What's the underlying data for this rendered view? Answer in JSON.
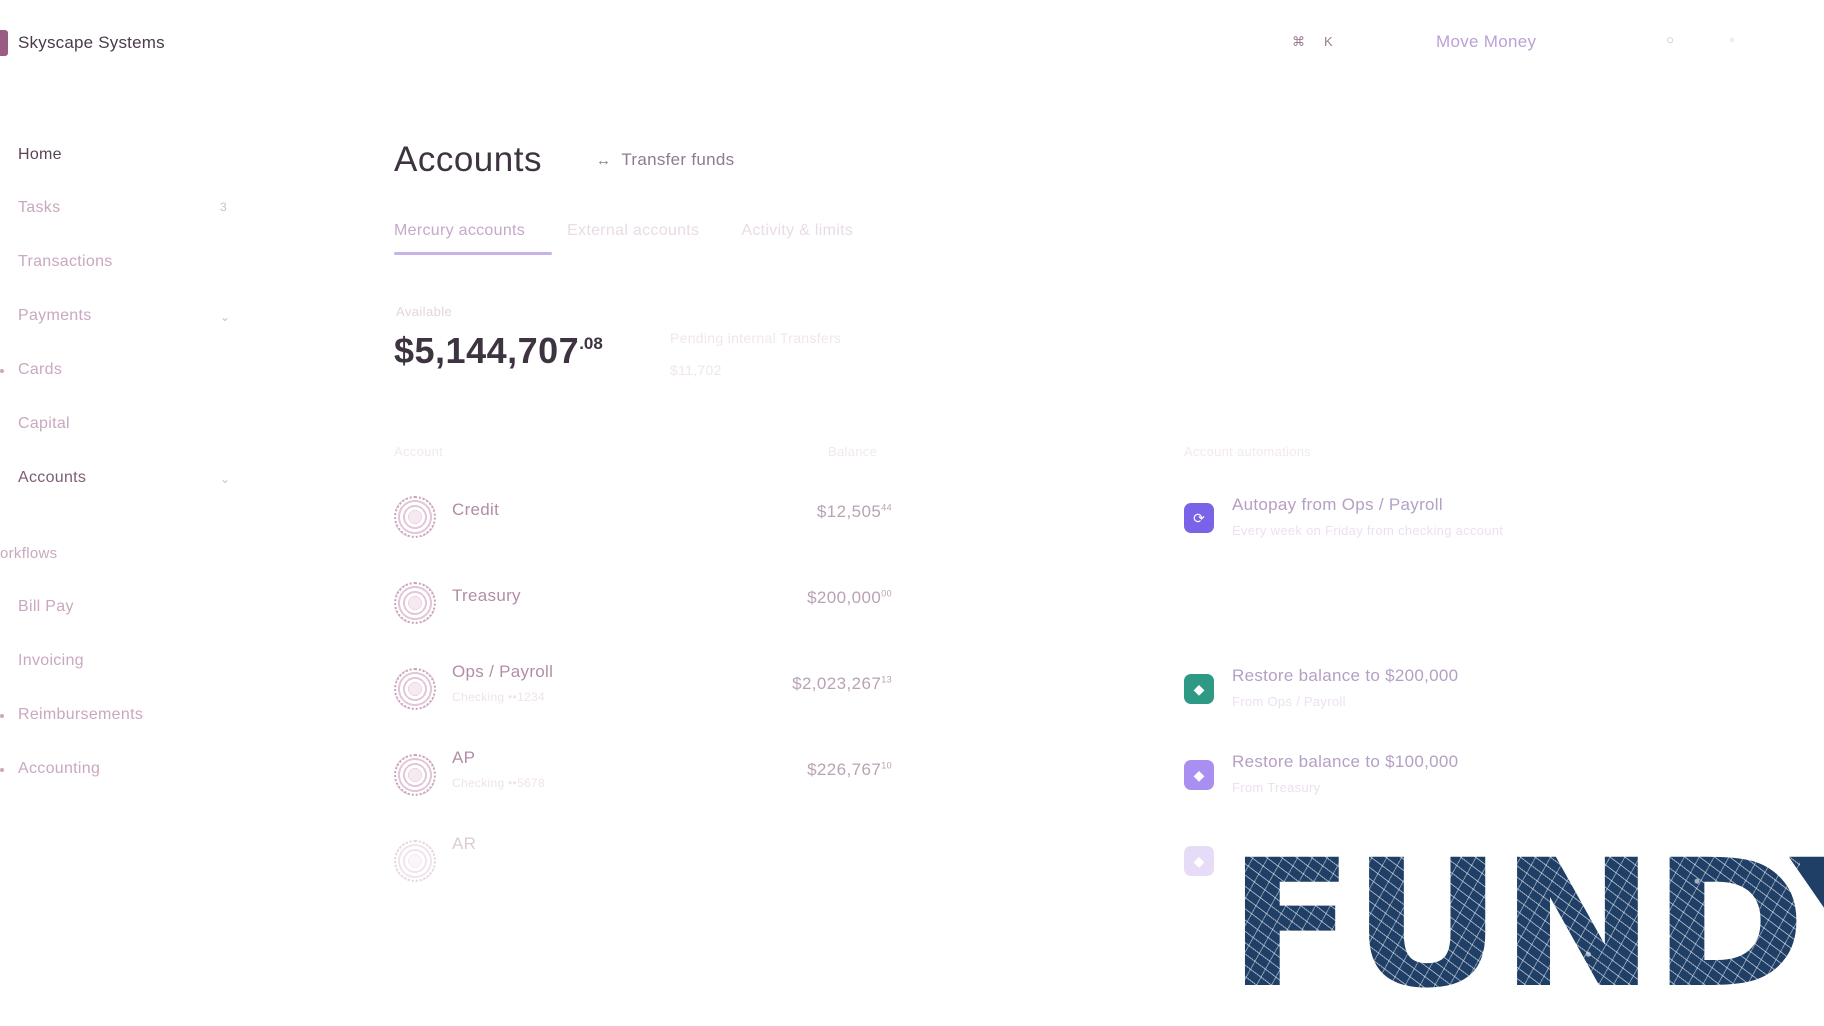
{
  "app": {
    "brand": "Skyscape Systems",
    "shortcut_keys": [
      "⌘",
      "K"
    ],
    "move_money": "Move Money"
  },
  "sidebar": {
    "items": [
      {
        "label": "Home",
        "icon": "home-icon",
        "state": "active"
      },
      {
        "label": "Tasks",
        "icon": "tasks-icon",
        "badge": "3"
      },
      {
        "label": "Transactions",
        "icon": "transactions-icon"
      },
      {
        "label": "Payments",
        "icon": "payments-icon",
        "has_chevron": true
      },
      {
        "label": "Cards",
        "icon": "cards-icon"
      },
      {
        "label": "Capital",
        "icon": "capital-icon"
      },
      {
        "label": "Accounts",
        "icon": "accounts-icon",
        "state": "open",
        "has_chevron": true
      }
    ],
    "section_label": "orkflows",
    "workflow_items": [
      {
        "label": "Bill Pay",
        "icon": "bill-pay-icon"
      },
      {
        "label": "Invoicing",
        "icon": "invoicing-icon"
      },
      {
        "label": "Reimbursements",
        "icon": "reimbursements-icon"
      },
      {
        "label": "Accounting",
        "icon": "accounting-icon"
      }
    ]
  },
  "page": {
    "title": "Accounts",
    "transfer_label": "Transfer funds",
    "tabs": [
      {
        "label": "Mercury accounts",
        "active": true
      },
      {
        "label": "External accounts",
        "active": false
      },
      {
        "label": "Activity & limits",
        "active": false
      }
    ],
    "available_label": "Available",
    "balance_main": "$5,144,707",
    "balance_cents": ".08",
    "pending_label": "Pending internal Transfers",
    "pending_value": "$11,702",
    "columns": {
      "account": "Account",
      "balance": "Balance",
      "automations": "Account automations"
    }
  },
  "accounts": [
    {
      "name": "Credit",
      "sub": "",
      "balance": "$12,505",
      "cents": "44"
    },
    {
      "name": "Treasury",
      "sub": "",
      "balance": "$200,000",
      "cents": "00"
    },
    {
      "name": "Ops / Payroll",
      "sub": "Checking ••1234",
      "balance": "$2,023,267",
      "cents": "13"
    },
    {
      "name": "AP",
      "sub": "Checking ••5678",
      "balance": "$226,767",
      "cents": "10"
    },
    {
      "name": "AR",
      "sub": "",
      "balance": "",
      "cents": ""
    }
  ],
  "automations": [
    {
      "title": "Autopay from Ops / Payroll",
      "sub": "Every week on Friday from checking account",
      "icon": "autopay-icon",
      "color": "#7a63e8"
    },
    {
      "title": "Restore balance to $200,000",
      "sub": "From Ops / Payroll",
      "icon": "restore-icon",
      "color": "#2e9a86"
    },
    {
      "title": "Restore balance to $100,000",
      "sub": "From Treasury",
      "icon": "restore-icon",
      "color": "#a98ff1"
    },
    {
      "title": "",
      "sub": "",
      "icon": "restore-icon",
      "color": "#e7dcf8"
    }
  ],
  "watermark": {
    "text": "FUNDYI"
  },
  "colors": {
    "accent": "#c7b3e6",
    "text_dark": "#3e3340",
    "text_muted": "#c9a8c0",
    "watermark": "#1f3f66"
  }
}
